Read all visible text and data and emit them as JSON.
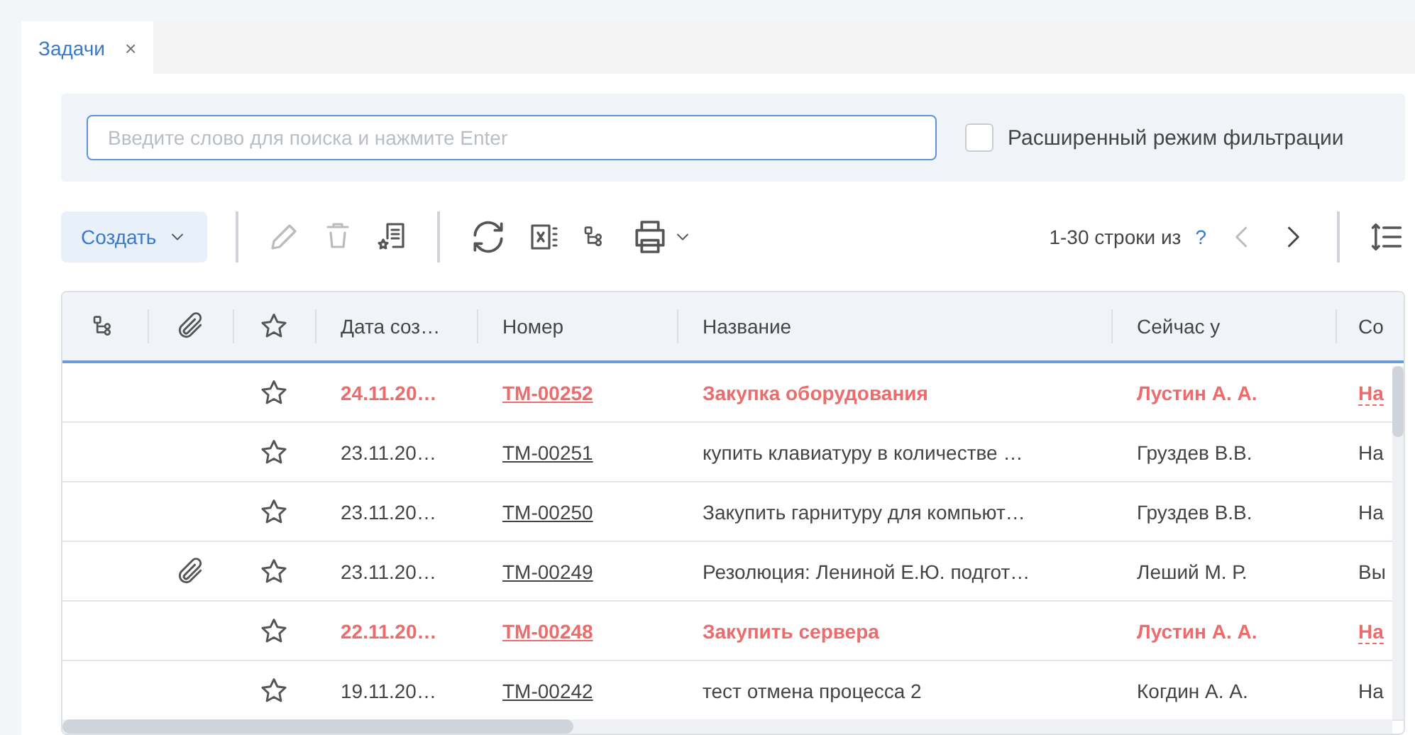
{
  "tabs": [
    {
      "label": "Задачи",
      "selected": true,
      "close": "×"
    }
  ],
  "search": {
    "placeholder": "Введите слово для поиска и нажмите Enter"
  },
  "advanced_filter": {
    "label": "Расширенный режим фильтрации",
    "checked": false
  },
  "toolbar": {
    "create_label": "Создать",
    "paging_text": "1-30 строки из",
    "total": "?",
    "prev_disabled": true,
    "next_disabled": false
  },
  "table": {
    "columns": [
      "Дата соз…",
      "Номер",
      "Название",
      "Сейчас у",
      "Со"
    ],
    "rows": [
      {
        "date": "24.11.20…",
        "number": "ТМ-00252",
        "title": "Закупка оборудования",
        "assignee": "Лустин А. А.",
        "column_5": "На",
        "overdue": true,
        "attachment": false,
        "starred": false
      },
      {
        "date": "23.11.20…",
        "number": "ТМ-00251",
        "title": "купить клавиатуру в количестве …",
        "assignee": "Груздев В.В.",
        "column_5": "На",
        "overdue": false,
        "attachment": false,
        "starred": false
      },
      {
        "date": "23.11.20…",
        "number": "ТМ-00250",
        "title": "Закупить гарнитуру для компьют…",
        "assignee": "Груздев В.В.",
        "column_5": "На",
        "overdue": false,
        "attachment": false,
        "starred": false
      },
      {
        "date": "23.11.20…",
        "number": "ТМ-00249",
        "title": "Резолюция: Лениной Е.Ю. подгот…",
        "assignee": "Леший М. Р.",
        "column_5": "Вы",
        "overdue": false,
        "attachment": true,
        "starred": false
      },
      {
        "date": "22.11.20…",
        "number": "ТМ-00248",
        "title": "Закупить сервера",
        "assignee": "Лустин А. А.",
        "column_5": "На",
        "overdue": true,
        "attachment": false,
        "starred": false
      },
      {
        "date": "19.11.20…",
        "number": "ТМ-00242",
        "title": "тест отмена процесса 2",
        "assignee": "Когдин А. А.",
        "column_5": "На",
        "overdue": false,
        "attachment": false,
        "starred": false
      }
    ]
  }
}
